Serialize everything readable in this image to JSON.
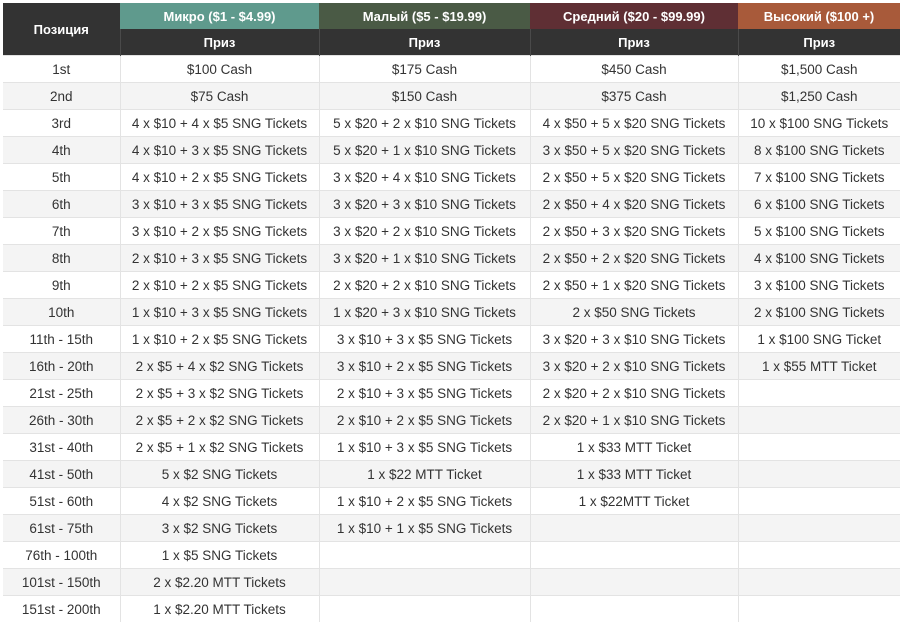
{
  "header": {
    "position_label": "Позиция",
    "tiers": [
      {
        "label": "Микро ($1 - $4.99)",
        "color": "#5f9a8d"
      },
      {
        "label": "Малый ($5 - $19.99)",
        "color": "#4a5a45"
      },
      {
        "label": "Средний ($20 - $99.99)",
        "color": "#5f2f34"
      },
      {
        "label": "Высокий ($100 +)",
        "color": "#a85a3a"
      }
    ],
    "prize_label": "Приз"
  },
  "rows": [
    {
      "pos": "1st",
      "micro": "$100 Cash",
      "small": "$175 Cash",
      "mid": "$450 Cash",
      "high": "$1,500 Cash"
    },
    {
      "pos": "2nd",
      "micro": "$75 Cash",
      "small": "$150 Cash",
      "mid": "$375 Cash",
      "high": "$1,250 Cash"
    },
    {
      "pos": "3rd",
      "micro": "4 x $10 + 4 x $5 SNG Tickets",
      "small": "5 x $20 + 2 x $10 SNG Tickets",
      "mid": "4 x $50 + 5 x $20 SNG Tickets",
      "high": "10 x $100 SNG Tickets"
    },
    {
      "pos": "4th",
      "micro": "4 x $10 + 3 x $5 SNG Tickets",
      "small": "5 x $20 + 1 x $10 SNG Tickets",
      "mid": "3 x $50 + 5 x $20 SNG Tickets",
      "high": "8 x $100 SNG Tickets"
    },
    {
      "pos": "5th",
      "micro": "4 x $10 + 2 x $5 SNG Tickets",
      "small": "3 x $20 + 4 x $10 SNG Tickets",
      "mid": "2 x $50 + 5 x $20 SNG Tickets",
      "high": "7 x $100 SNG Tickets"
    },
    {
      "pos": "6th",
      "micro": "3 x $10 + 3 x $5 SNG Tickets",
      "small": "3 x $20 + 3 x $10 SNG Tickets",
      "mid": "2 x $50 + 4 x $20 SNG Tickets",
      "high": "6 x $100 SNG Tickets"
    },
    {
      "pos": "7th",
      "micro": "3 x $10 + 2 x $5 SNG Tickets",
      "small": "3 x $20 + 2 x $10 SNG Tickets",
      "mid": "2 x $50 + 3 x $20 SNG Tickets",
      "high": "5 x $100 SNG Tickets"
    },
    {
      "pos": "8th",
      "micro": "2 x $10 + 3 x $5 SNG Tickets",
      "small": "3 x $20 + 1 x $10 SNG Tickets",
      "mid": "2 x $50 + 2 x $20 SNG Tickets",
      "high": "4 x $100 SNG Tickets"
    },
    {
      "pos": "9th",
      "micro": "2 x $10 + 2 x $5 SNG Tickets",
      "small": "2 x $20 + 2 x $10 SNG Tickets",
      "mid": "2 x $50 + 1 x $20 SNG Tickets",
      "high": "3 x $100 SNG Tickets"
    },
    {
      "pos": "10th",
      "micro": "1 x $10 + 3 x $5 SNG Tickets",
      "small": "1 x $20 + 3 x $10 SNG Tickets",
      "mid": "2 x $50 SNG Tickets",
      "high": "2 x $100 SNG Tickets"
    },
    {
      "pos": "11th - 15th",
      "micro": "1 x $10 + 2 x $5 SNG Tickets",
      "small": "3 x $10 + 3 x $5 SNG Tickets",
      "mid": "3 x $20 + 3 x $10 SNG Tickets",
      "high": "1 x $100 SNG Ticket"
    },
    {
      "pos": "16th - 20th",
      "micro": "2 x $5 + 4 x $2 SNG Tickets",
      "small": "3 x $10 + 2 x $5 SNG Tickets",
      "mid": "3 x $20 + 2 x $10 SNG Tickets",
      "high": "1 x $55 MTT Ticket"
    },
    {
      "pos": "21st - 25th",
      "micro": "2 x $5 + 3 x $2 SNG Tickets",
      "small": "2 x $10 + 3 x $5 SNG Tickets",
      "mid": "2 x $20 + 2 x $10 SNG Tickets",
      "high": ""
    },
    {
      "pos": "26th - 30th",
      "micro": "2 x $5 + 2 x $2 SNG Tickets",
      "small": "2 x $10 + 2 x $5 SNG Tickets",
      "mid": "2 x $20 + 1 x $10 SNG Tickets",
      "high": ""
    },
    {
      "pos": "31st - 40th",
      "micro": "2 x $5 + 1 x $2 SNG Tickets",
      "small": "1 x $10 + 3 x $5 SNG Tickets",
      "mid": "1 x $33 MTT Ticket",
      "high": ""
    },
    {
      "pos": "41st - 50th",
      "micro": "5 x $2 SNG Tickets",
      "small": "1 x $22 MTT Ticket",
      "mid": "1 x $33 MTT Ticket",
      "high": ""
    },
    {
      "pos": "51st - 60th",
      "micro": "4 x $2 SNG Tickets",
      "small": "1 x $10 + 2 x $5 SNG Tickets",
      "mid": "1 x $22MTT Ticket",
      "high": ""
    },
    {
      "pos": "61st - 75th",
      "micro": "3 x $2 SNG Tickets",
      "small": "1 x $10 + 1 x $5 SNG Tickets",
      "mid": "",
      "high": ""
    },
    {
      "pos": "76th - 100th",
      "micro": "1 x $5 SNG Tickets",
      "small": "",
      "mid": "",
      "high": ""
    },
    {
      "pos": "101st - 150th",
      "micro": "2 x $2.20 MTT Tickets",
      "small": "",
      "mid": "",
      "high": ""
    },
    {
      "pos": "151st - 200th",
      "micro": "1 x $2.20 MTT Tickets",
      "small": "",
      "mid": "",
      "high": ""
    }
  ]
}
